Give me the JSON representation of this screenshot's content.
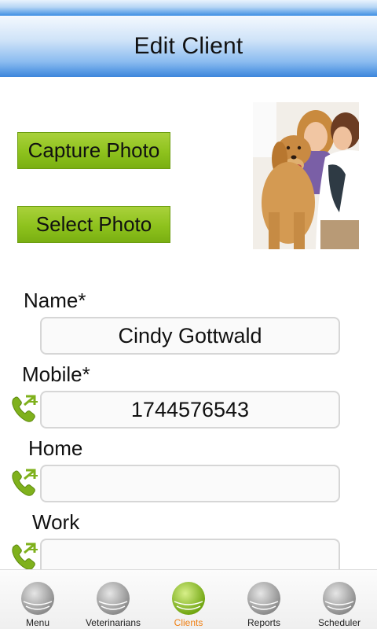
{
  "header": {
    "title": "Edit Client"
  },
  "photo_buttons": {
    "capture_label": "Capture Photo",
    "select_label": "Select Photo"
  },
  "form": {
    "name": {
      "label": "Name*",
      "value": "Cindy Gottwald"
    },
    "mobile": {
      "label": "Mobile*",
      "value": "1744576543"
    },
    "home": {
      "label": "Home",
      "value": ""
    },
    "work": {
      "label": "Work",
      "value": ""
    }
  },
  "nav": {
    "items": [
      {
        "label": "Menu",
        "active": false
      },
      {
        "label": "Veterinarians",
        "active": false
      },
      {
        "label": "Clients",
        "active": true
      },
      {
        "label": "Reports",
        "active": false
      },
      {
        "label": "Scheduler",
        "active": false
      }
    ]
  },
  "icons": {
    "call": "phone-call-icon",
    "nav_ball": "nav-ball-icon"
  },
  "colors": {
    "header_blue": "#3c86dc",
    "button_green": "#8ec21d",
    "active_nav": "#f07f12",
    "phone_green": "#7fb11c"
  }
}
